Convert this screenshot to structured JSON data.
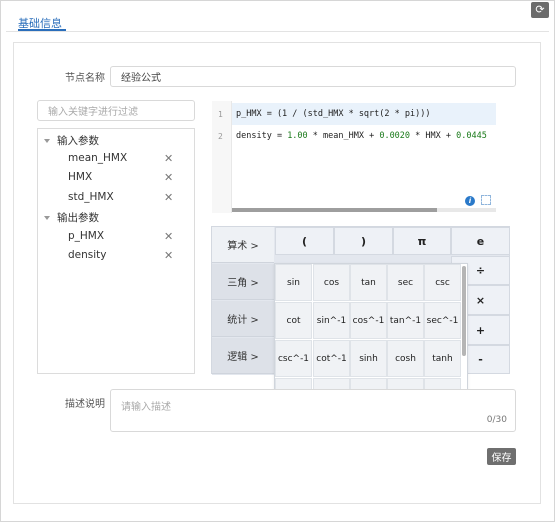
{
  "window": {
    "refresh_icon": "refresh-icon"
  },
  "tabs": [
    {
      "label": "基础信息",
      "active": true
    }
  ],
  "form": {
    "node_name_label": "节点名称",
    "node_name_value": "经验公式",
    "description_label": "描述说明",
    "description_placeholder": "请输入描述",
    "description_count": "0/30",
    "save_label": "保存"
  },
  "tree": {
    "search_placeholder": "输入关键字进行过滤",
    "input_group": {
      "label": "输入参数",
      "items": [
        "mean_HMX",
        "HMX",
        "std_HMX"
      ]
    },
    "output_group": {
      "label": "输出参数",
      "items": [
        "p_HMX",
        "density"
      ]
    }
  },
  "editor": {
    "lines": [
      {
        "no": "1",
        "code": "p_HMX = (1 / (std_HMX * sqrt(2 * pi)))"
      },
      {
        "no": "2",
        "code_prefix": "density = ",
        "n1": "1.00",
        "code_mid1": " * mean_HMX + ",
        "n2": "0.0020",
        "code_mid2": " * HMX + ",
        "n3": "0.0445"
      }
    ]
  },
  "calculator": {
    "categories": [
      {
        "label": "算术 >",
        "active": true
      },
      {
        "label": "三角 >",
        "active": false
      },
      {
        "label": "统计 >",
        "active": false
      },
      {
        "label": "逻辑 >",
        "active": false
      }
    ],
    "top_keys": [
      "(",
      ")",
      "π",
      "e"
    ],
    "side_keys": [
      "÷",
      "×",
      "+",
      "-"
    ],
    "trig_keys": [
      [
        "sin",
        "cos",
        "tan",
        "sec",
        "csc"
      ],
      [
        "cot",
        "sin^-1",
        "cos^-1",
        "tan^-1",
        "sec^-1"
      ],
      [
        "csc^-1",
        "cot^-1",
        "sinh",
        "cosh",
        "tanh"
      ]
    ]
  },
  "colors": {
    "accent": "#2a6ebb",
    "save_bg": "#6f6f6f",
    "info": "#2a79c9"
  }
}
